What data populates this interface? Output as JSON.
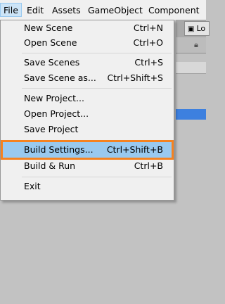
{
  "menubar": {
    "items": [
      {
        "label": "File"
      },
      {
        "label": "Edit"
      },
      {
        "label": "Assets"
      },
      {
        "label": "GameObject"
      },
      {
        "label": "Component"
      }
    ]
  },
  "background": {
    "tab_label": "Lo"
  },
  "file_menu": {
    "items": [
      {
        "label": "New Scene",
        "shortcut": "Ctrl+N"
      },
      {
        "label": "Open Scene",
        "shortcut": "Ctrl+O"
      },
      {
        "label": "Save Scenes",
        "shortcut": "Ctrl+S"
      },
      {
        "label": "Save Scene as...",
        "shortcut": "Ctrl+Shift+S"
      },
      {
        "label": "New Project...",
        "shortcut": ""
      },
      {
        "label": "Open Project...",
        "shortcut": ""
      },
      {
        "label": "Save Project",
        "shortcut": ""
      },
      {
        "label": "Build Settings...",
        "shortcut": "Ctrl+Shift+B"
      },
      {
        "label": "Build & Run",
        "shortcut": "Ctrl+B"
      },
      {
        "label": "Exit",
        "shortcut": ""
      }
    ],
    "highlighted_item": "Build Settings..."
  },
  "colors": {
    "highlight": "#99c9ef",
    "annotation_outline": "#f58220"
  }
}
